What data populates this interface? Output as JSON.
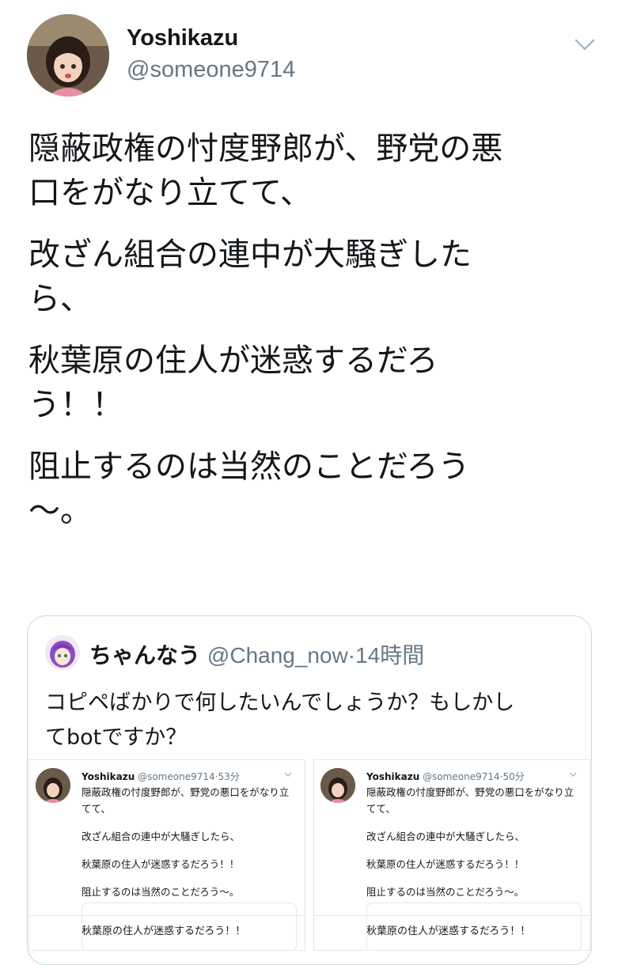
{
  "user": {
    "name": "Yoshikazu",
    "handle": "@someone9714"
  },
  "tweet": {
    "paragraphs": [
      "隠蔽政権の忖度野郎が、野党の悪\n口をがなり立てて、",
      "改ざん組合の連中が大騒ぎした\nら、",
      "秋葉原の住人が迷惑するだろ\nう！！",
      "阻止するのは当然のことだろう\n〜。"
    ]
  },
  "quote": {
    "name": "ちゃんなう",
    "handle": "@Chang_now",
    "separator": "·",
    "time": "14時間",
    "text": "コピペばかりで何したいんでしょうか？もしかし\nてbotですか？"
  },
  "screenshots": [
    {
      "name": "Yoshikazu",
      "handle": "@someone9714",
      "time": "53分",
      "lines": [
        "隠蔽政権の忖度野郎が、野党の悪口をがなり立てて、",
        "改ざん組合の連中が大騒ぎしたら、",
        "秋葉原の住人が迷惑するだろう！！",
        "阻止するのは当然のことだろう〜。"
      ],
      "bottom": "秋葉原の住人が迷惑するだろう！！"
    },
    {
      "name": "Yoshikazu",
      "handle": "@someone9714",
      "time": "50分",
      "lines": [
        "隠蔽政権の忖度野郎が、野党の悪口をがなり立てて、",
        "改ざん組合の連中が大騒ぎしたら、",
        "秋葉原の住人が迷惑するだろう！！",
        "阻止するのは当然のことだろう〜。"
      ],
      "bottom": "秋葉原の住人が迷惑するだろう！！"
    }
  ],
  "icons": {
    "menu": "chevron-down-icon",
    "avatar": "anime-avatar",
    "quote_avatar": "purple-anime-avatar"
  },
  "colors": {
    "text": "#14171a",
    "secondary": "#657786",
    "border": "#ccd6dd"
  }
}
